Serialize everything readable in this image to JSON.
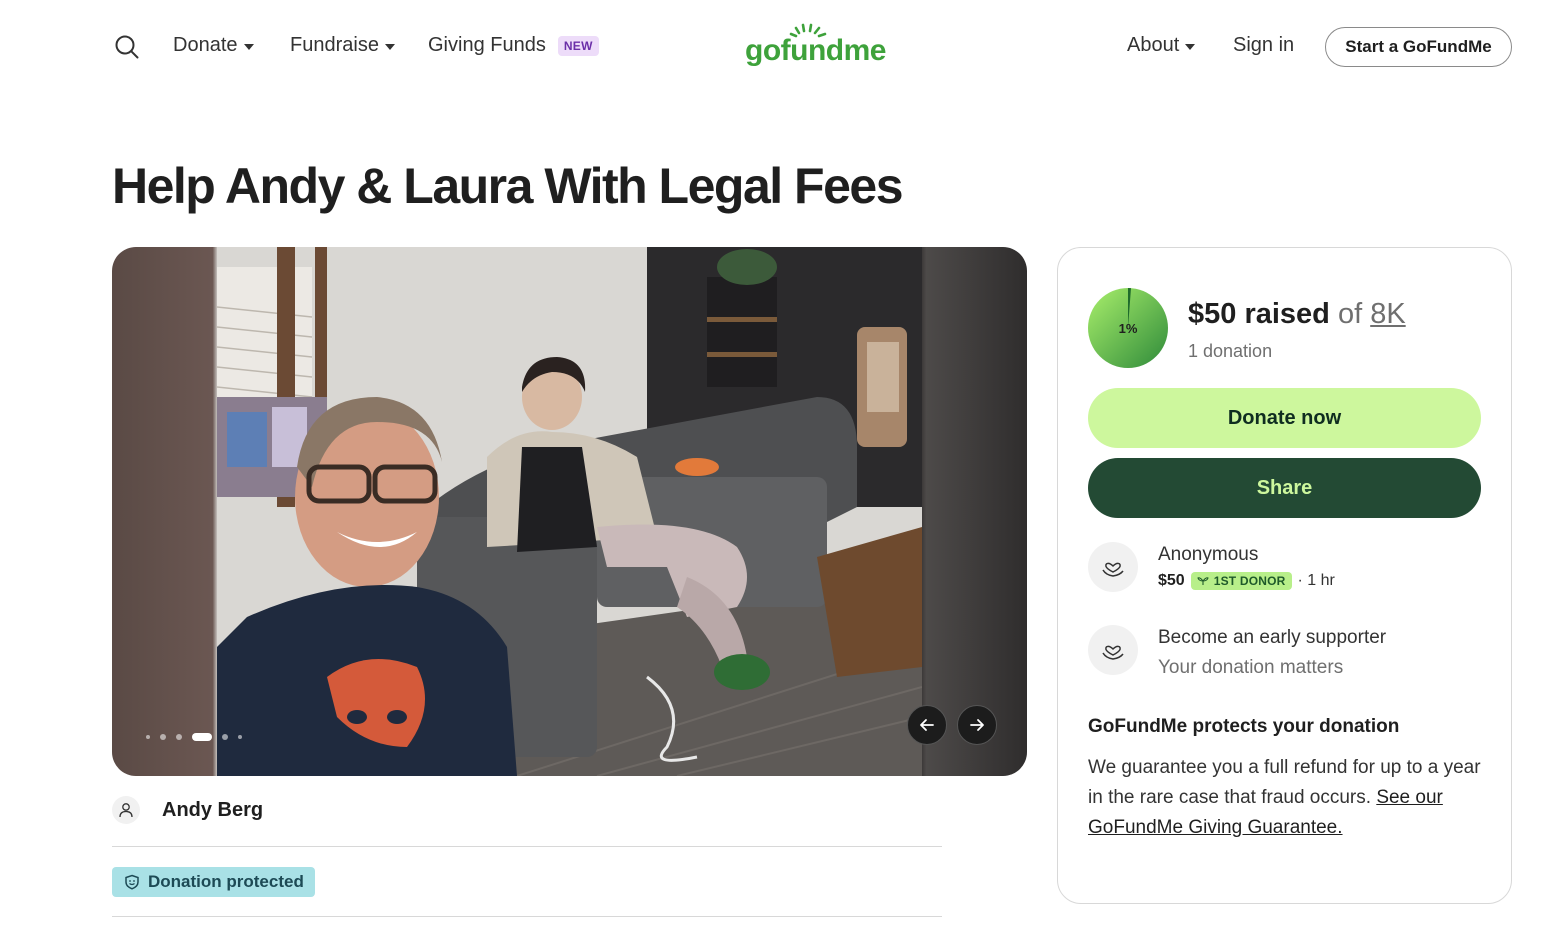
{
  "header": {
    "nav": [
      {
        "label": "Donate",
        "has_caret": true
      },
      {
        "label": "Fundraise",
        "has_caret": true
      },
      {
        "label": "Giving Funds",
        "badge": "NEW"
      }
    ],
    "logo": "gofundme",
    "about": "About",
    "sign_in": "Sign in",
    "start_button": "Start a GoFundMe",
    "icons": {
      "search": "search-icon",
      "logo": "gofundme-logo-sun"
    }
  },
  "campaign": {
    "title": "Help Andy & Laura With Legal Fees",
    "organizer": "Andy Berg",
    "protected_badge": "Donation protected",
    "carousel": {
      "total_slides": 6,
      "active_slide": 4
    }
  },
  "sidebar": {
    "progress_label": "1%",
    "progress_fraction": 0.01,
    "raised": "$50 raised",
    "of": "of",
    "goal": "8K",
    "donation_count": "1 donation",
    "donate_button": "Donate now",
    "share_button": "Share",
    "recent_donor": {
      "name": "Anonymous",
      "amount": "$50",
      "badge": "1ST DONOR",
      "time": "· 1 hr"
    },
    "early_supporter": {
      "title": "Become an early supporter",
      "subtitle": "Your donation matters"
    },
    "protection": {
      "title": "GoFundMe protects your donation",
      "text": "We guarantee you a full refund for up to a year in the rare case that fraud occurs. ",
      "link": "See our GoFundMe Giving Guarantee."
    }
  },
  "colors": {
    "brand_green": "#3ea23b",
    "donate_button": "#cdf79d",
    "share_button": "#234a34",
    "protected_badge": "#a9e1e6",
    "first_donor_badge": "#b8ef8a",
    "new_badge": "#eddcf9"
  }
}
